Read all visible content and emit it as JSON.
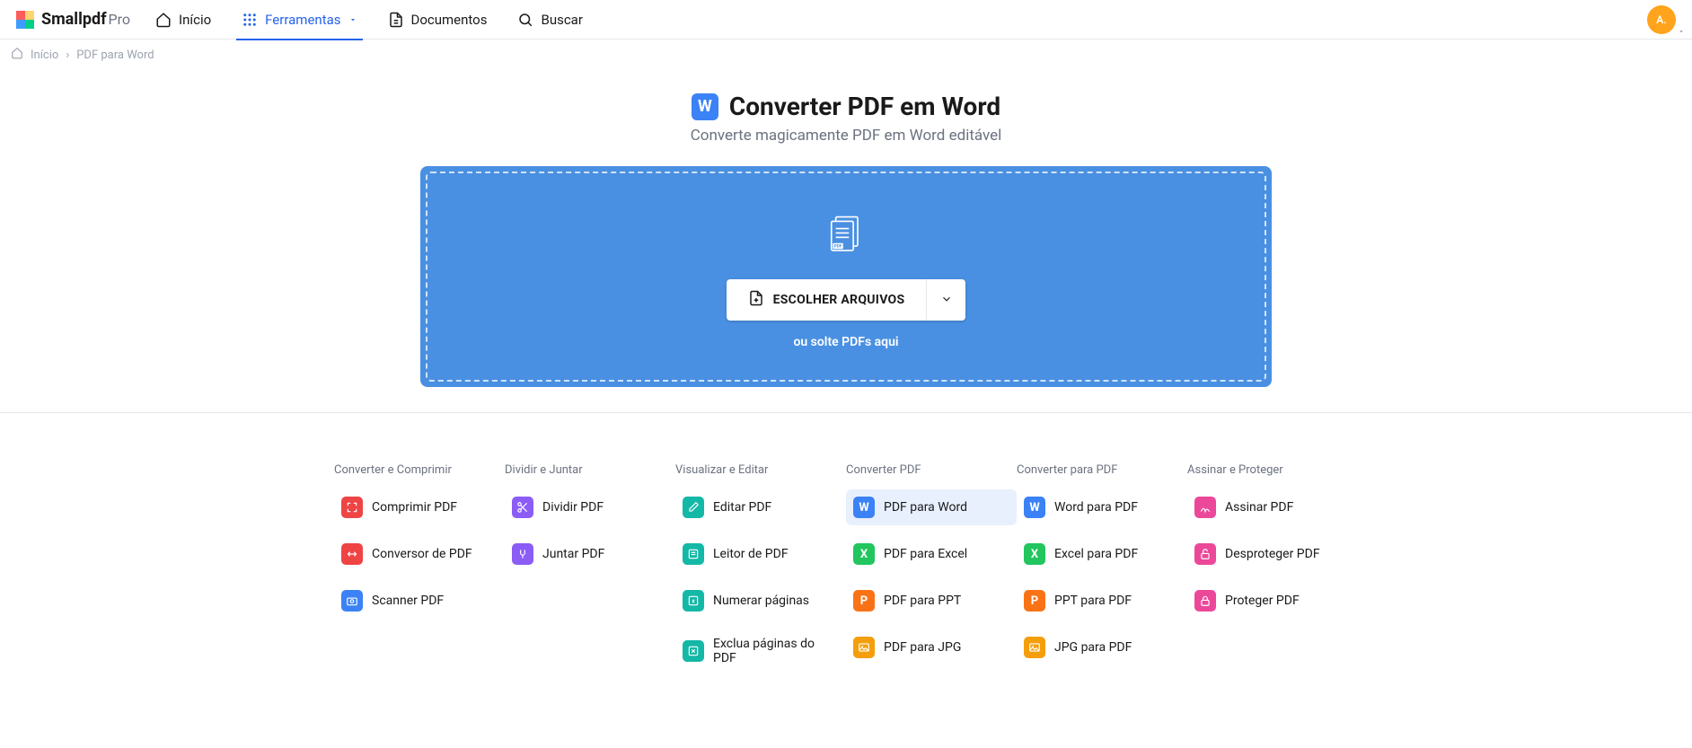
{
  "brand": {
    "name": "Smallpdf",
    "tier": "Pro"
  },
  "nav": {
    "home": "Início",
    "tools": "Ferramentas",
    "documents": "Documentos",
    "search": "Buscar"
  },
  "avatar": {
    "initials": "A."
  },
  "breadcrumb": {
    "home": "Início",
    "current": "PDF para Word"
  },
  "hero": {
    "icon_letter": "W",
    "title": "Converter PDF em Word",
    "subtitle": "Converte magicamente PDF em Word editável"
  },
  "dropzone": {
    "button": "ESCOLHER ARQUIVOS",
    "hint": "ou solte PDFs aqui"
  },
  "tool_columns": [
    {
      "heading": "Converter e Comprimir",
      "items": [
        {
          "label": "Comprimir PDF",
          "color": "c-red",
          "icon": "compress"
        },
        {
          "label": "Conversor de PDF",
          "color": "c-red",
          "icon": "convert"
        },
        {
          "label": "Scanner PDF",
          "color": "c-blue",
          "icon": "camera"
        }
      ]
    },
    {
      "heading": "Dividir e Juntar",
      "items": [
        {
          "label": "Dividir PDF",
          "color": "c-purple",
          "icon": "scissors"
        },
        {
          "label": "Juntar PDF",
          "color": "c-purple",
          "icon": "merge"
        }
      ]
    },
    {
      "heading": "Visualizar e Editar",
      "items": [
        {
          "label": "Editar PDF",
          "color": "c-teal",
          "icon": "edit"
        },
        {
          "label": "Leitor de PDF",
          "color": "c-teal",
          "icon": "read"
        },
        {
          "label": "Numerar páginas",
          "color": "c-teal",
          "icon": "number"
        },
        {
          "label": "Exclua páginas do PDF",
          "color": "c-teal",
          "icon": "delete"
        }
      ]
    },
    {
      "heading": "Converter PDF",
      "items": [
        {
          "label": "PDF para Word",
          "color": "c-blue",
          "letter": "W",
          "active": true
        },
        {
          "label": "PDF para Excel",
          "color": "c-green",
          "letter": "X"
        },
        {
          "label": "PDF para PPT",
          "color": "c-orange",
          "letter": "P"
        },
        {
          "label": "PDF para JPG",
          "color": "c-yellow",
          "icon": "image"
        }
      ]
    },
    {
      "heading": "Converter para PDF",
      "items": [
        {
          "label": "Word para PDF",
          "color": "c-blue",
          "letter": "W"
        },
        {
          "label": "Excel para PDF",
          "color": "c-green",
          "letter": "X"
        },
        {
          "label": "PPT para PDF",
          "color": "c-orange",
          "letter": "P"
        },
        {
          "label": "JPG para PDF",
          "color": "c-yellow",
          "icon": "image"
        }
      ]
    },
    {
      "heading": "Assinar e Proteger",
      "items": [
        {
          "label": "Assinar PDF",
          "color": "c-pink",
          "icon": "sign"
        },
        {
          "label": "Desproteger PDF",
          "color": "c-pink",
          "icon": "unlock"
        },
        {
          "label": "Proteger PDF",
          "color": "c-pink",
          "icon": "lock"
        }
      ]
    }
  ]
}
